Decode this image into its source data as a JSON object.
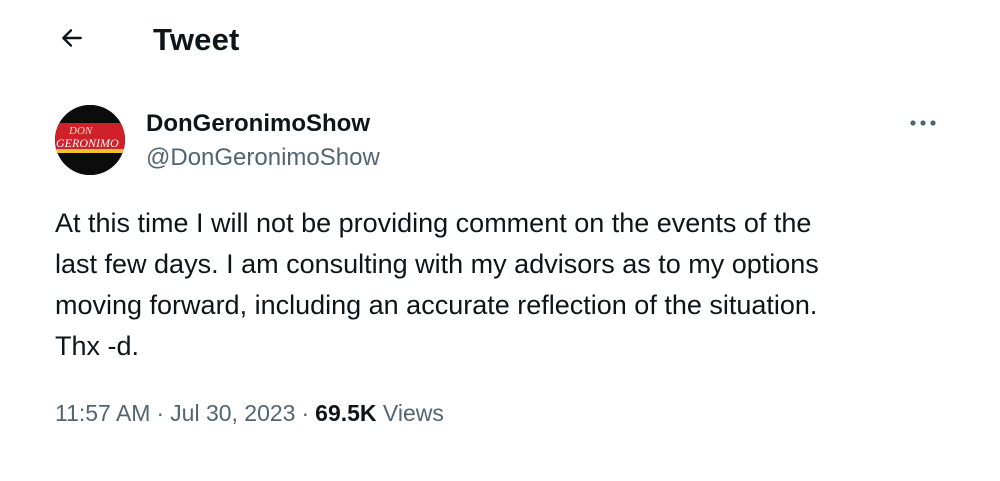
{
  "header": {
    "title": "Tweet",
    "back_icon": "arrow-left-icon"
  },
  "author": {
    "display_name": "DonGeronimoShow",
    "handle": "@DonGeronimoShow",
    "avatar_text_top": "DON",
    "avatar_text_bottom": "GERONIMO"
  },
  "more_icon": "more-horizontal-icon",
  "tweet": {
    "text": "At this time I will not be providing comment on the events of the\nlast few days. I am consulting with my advisors as to my options\nmoving forward, including an accurate reflection of the situation.\nThx -d."
  },
  "meta": {
    "time": "11:57 AM",
    "separator": "·",
    "date": "Jul 30, 2023",
    "views_count": "69.5K",
    "views_label": "Views"
  },
  "colors": {
    "text_primary": "#0f1419",
    "text_secondary": "#536471",
    "background": "#ffffff",
    "avatar_red": "#d0202a",
    "avatar_yellow": "#f2c230"
  }
}
